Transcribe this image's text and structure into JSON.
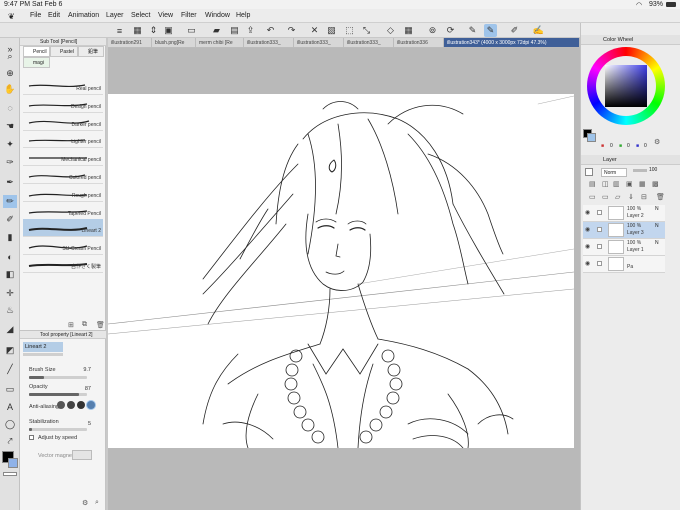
{
  "status": {
    "time": "9:47 PM",
    "date": "Sat Feb 6",
    "battery": "93%"
  },
  "menu": [
    "File",
    "Edit",
    "Animation",
    "Layer",
    "Select",
    "View",
    "Filter",
    "Window",
    "Help"
  ],
  "tabs": [
    {
      "label": "illustration291",
      "active": false
    },
    {
      "label": "blush.png[Re",
      "active": false
    },
    {
      "label": "merm chibi [Re",
      "active": false
    },
    {
      "label": "illustration333_",
      "active": false
    },
    {
      "label": "illustration333_",
      "active": false
    },
    {
      "label": "illustration333_",
      "active": false
    },
    {
      "label": "illustration336",
      "active": false
    },
    {
      "label": "illustration343* (4000 x 3000px 72dpi 47.3%)",
      "active": true
    }
  ],
  "subtool": {
    "header": "Sub Tool [Pencil]",
    "tabs": [
      "Pencil",
      "Pastel",
      "鉛筆",
      "magi"
    ],
    "brushes": [
      {
        "label": "Real pencil",
        "active": false
      },
      {
        "label": "Design pencil",
        "active": false
      },
      {
        "label": "Darker pencil",
        "active": false
      },
      {
        "label": "Lighter pencil",
        "active": false
      },
      {
        "label": "Mechanical pencil",
        "active": false
      },
      {
        "label": "Colored pencil",
        "active": false
      },
      {
        "label": "Rough pencil",
        "active": false
      },
      {
        "label": "Tapered Pencil",
        "active": false
      },
      {
        "label": "Lineart 2",
        "active": true
      },
      {
        "label": "SU-Cream Pencil",
        "active": false
      },
      {
        "label": "自作ざく製筆",
        "active": false
      }
    ]
  },
  "toolprop": {
    "header": "Tool property [Lineart 2]",
    "name": "Lineart 2",
    "brush_size_label": "Brush Size",
    "brush_size_value": "9.7",
    "opacity_label": "Opacity",
    "opacity_value": "87",
    "opacity_fraction": 0.87,
    "brush_size_fraction": 0.25,
    "antialias_label": "Anti-aliasing",
    "stabilization_label": "Stabilization",
    "stabilization_value": "5",
    "stabilization_fraction": 0.05,
    "adjust_speed_label": "Adjust by speed",
    "vector_magnet_label": "Vector magnet"
  },
  "color": {
    "panel_title": "Color Wheel",
    "r_value": "0",
    "g_value": "0",
    "b_value": "0",
    "current": "#000000"
  },
  "layers": {
    "panel_title": "Layer",
    "blend_mode": "Norm",
    "opacity": "100",
    "rows": [
      {
        "pct": "100 %",
        "suffix": "N",
        "name": "Layer 2",
        "active": false
      },
      {
        "pct": "100 %",
        "suffix": "N",
        "name": "Layer 3",
        "active": true
      },
      {
        "pct": "100 %",
        "suffix": "N",
        "name": "Layer 1",
        "active": false
      },
      {
        "pct": "",
        "suffix": "",
        "name": "Pa",
        "active": false
      }
    ]
  },
  "colors": {
    "accent": "#9fc4ea",
    "tab_active": "#3f5f98",
    "selected_row": "#c2d6ee"
  }
}
